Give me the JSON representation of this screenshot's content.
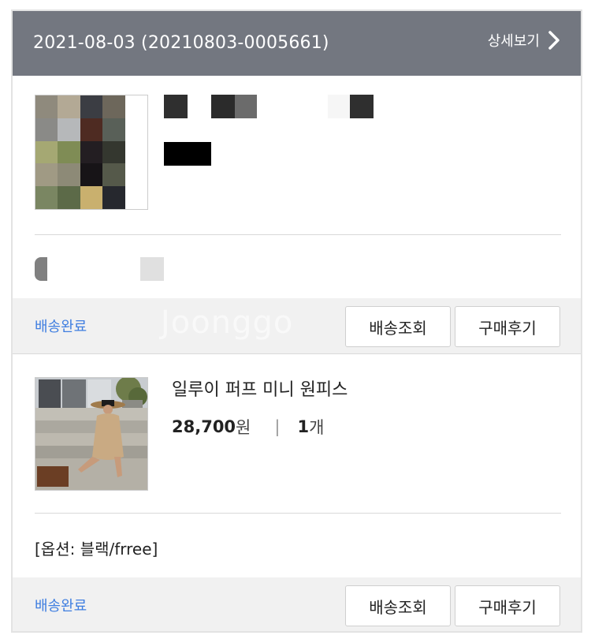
{
  "order": {
    "date_header": "2021-08-03 (20210803-0005661)",
    "detail_link": "상세보기"
  },
  "watermark": "Joonggo",
  "items": [
    {
      "status": "배송완료",
      "btn_track": "배송조회",
      "btn_review": "구매후기"
    },
    {
      "name": "일루이 퍼프 미니 원피스",
      "price": "28,700",
      "price_unit": "원",
      "separator": "|",
      "qty": "1",
      "qty_unit": "개",
      "option": "[옵션: 블랙/frree]",
      "status": "배송완료",
      "btn_track": "배송조회",
      "btn_review": "구매후기"
    }
  ],
  "colors": {
    "header_bg": "#737780",
    "status_blue": "#3f7ee0",
    "status_bar_bg": "#f1f1f1"
  }
}
